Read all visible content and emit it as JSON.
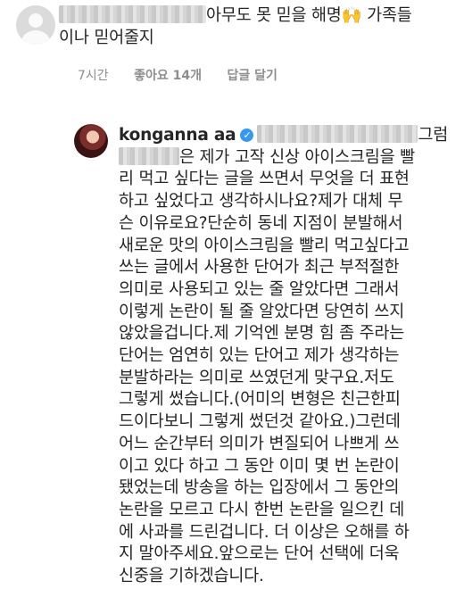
{
  "comment1": {
    "text_part1": "아무도 못 믿을 해명",
    "emoji": "🙌",
    "text_part2": " 가족들",
    "line2": "이나 믿어줄지",
    "time": "7시간",
    "likes": "좋아요 14개",
    "reply": "답글 달기"
  },
  "comment2": {
    "username": "konganna aa",
    "line1_tail": "그럼",
    "line2_tail": "은 제가 고작 신상 아이스크림을 빨",
    "lines": [
      "리 먹고 싶다는 글을 쓰면서 무엇을 더 표현",
      "하고 싶었다고 생각하시나요?제가 대체 무",
      "슨 이유로요?단순히 동네 지점이 분발해서",
      "새로운 맛의 아이스크림을 빨리 먹고싶다고",
      "쓰는 글에서 사용한 단어가 최근 부적절한",
      "의미로 사용되고 있는 줄 알았다면 그래서",
      "이렇게 논란이 될 줄 알았다면 당연히 쓰지",
      "않았을겁니다.제 기억엔 분명 힘 좀 주라는",
      "단어는 엄연히 있는 단어고 제가 생각하는",
      "분발하라는 의미로 쓰였던게 맞구요.저도",
      "그렇게 썼습니다.(어미의 변형은 친근한피",
      "드이다보니 그렇게 썼던것 같아요.)그런데",
      "어느 순간부터 의미가 변질되어 나쁘게 쓰",
      "이고 있다 하고 그 동안 이미 몇 번 논란이",
      "됐었는데 방송을 하는 입장에서 그 동안의",
      "논란을 모르고 다시 한번 논란을 일으킨 데",
      "에 사과를 드린겁니다. 더 이상은 오해를 하",
      "지 말아주세요.앞으로는 단어 선택에 더욱",
      "신중을 기하겠습니다."
    ]
  }
}
